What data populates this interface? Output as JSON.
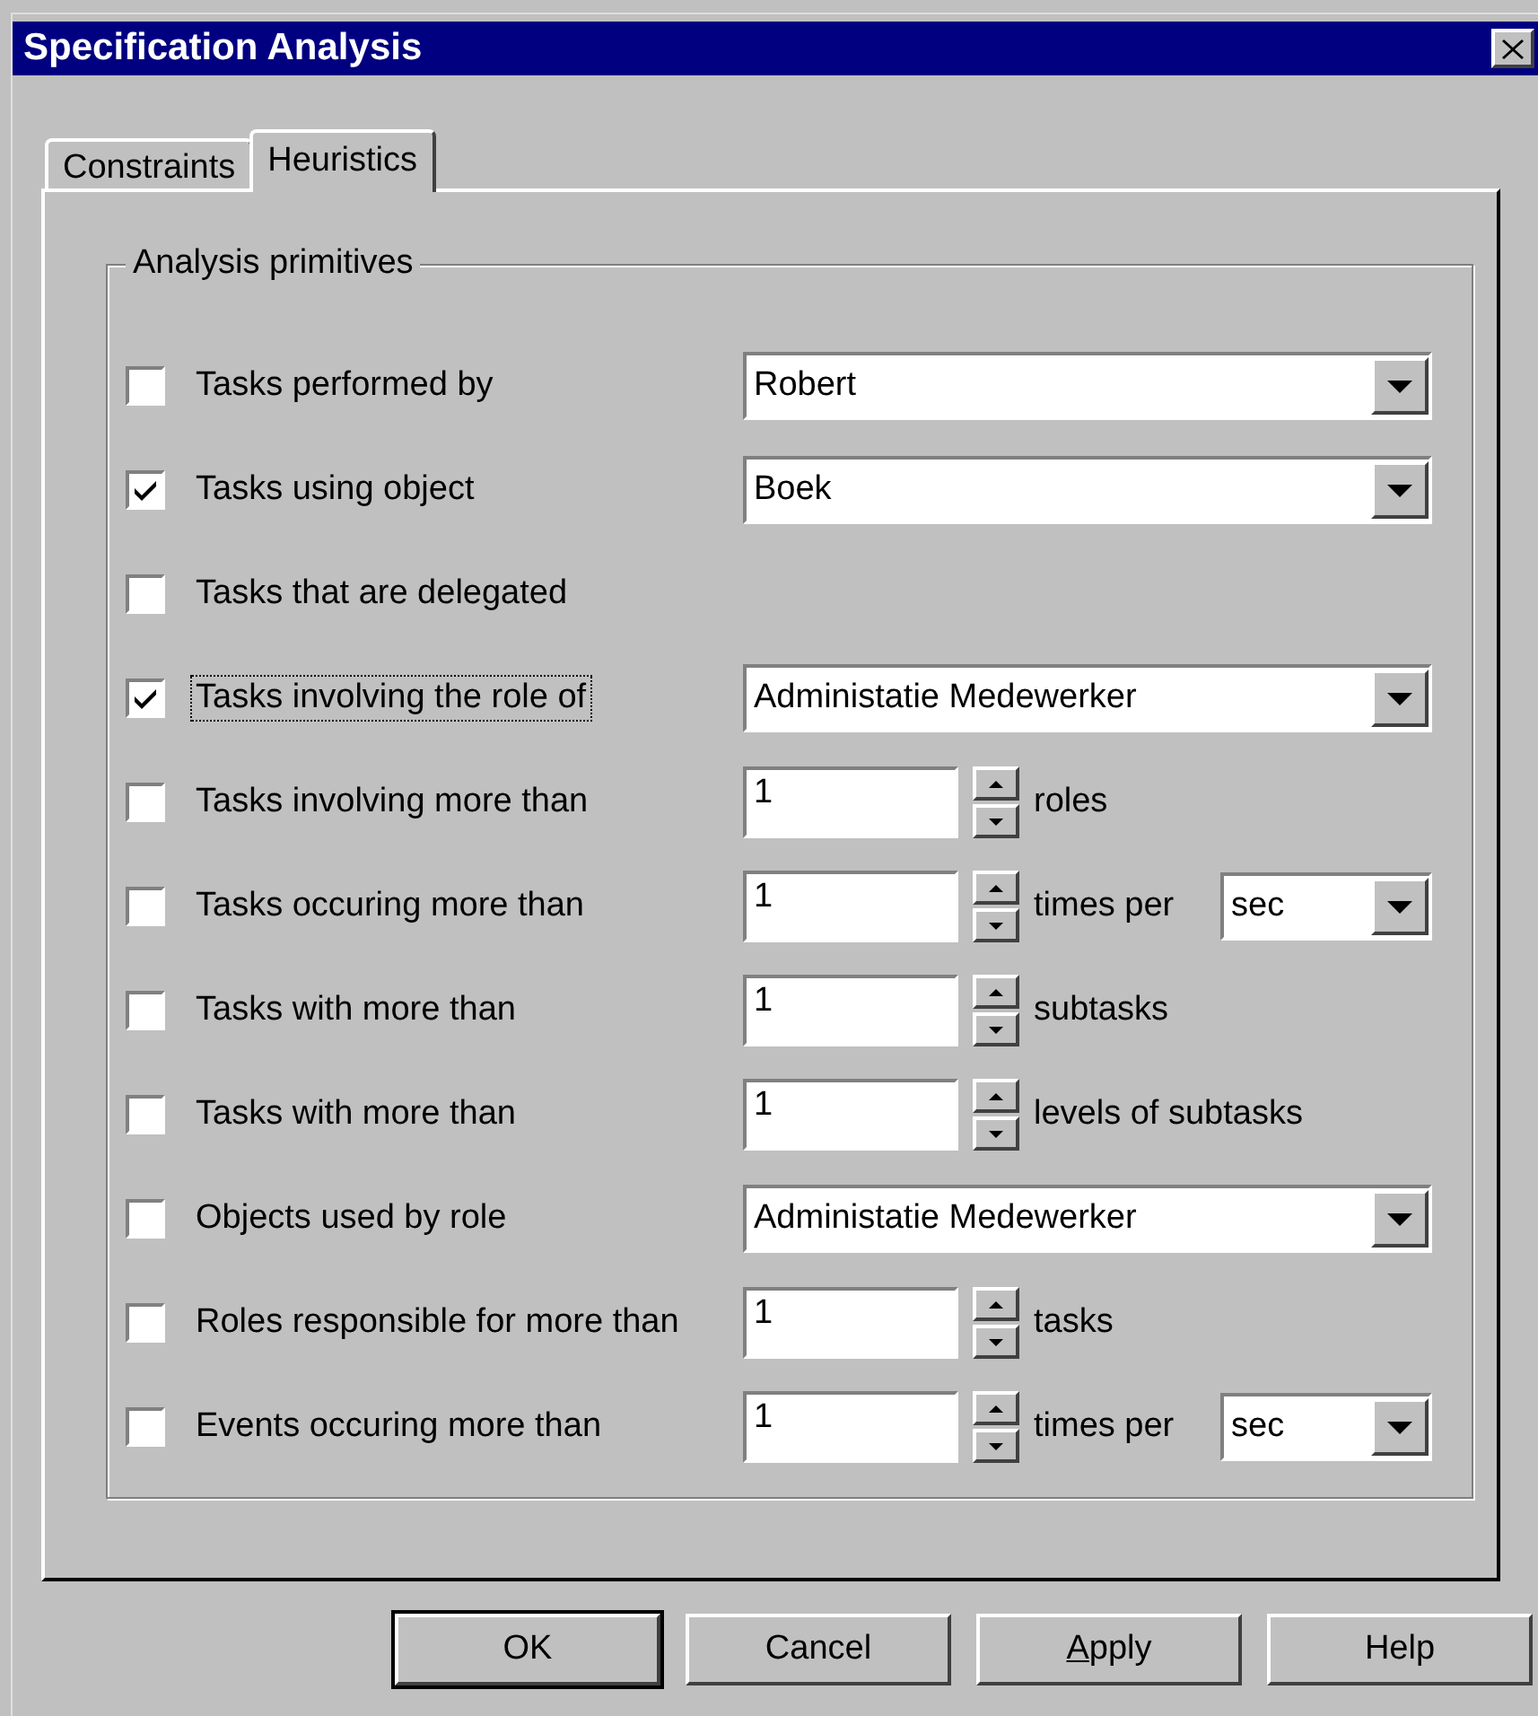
{
  "window": {
    "title": "Specification Analysis"
  },
  "tabs": [
    {
      "label": "Constraints",
      "selected": false
    },
    {
      "label": "Heuristics",
      "selected": true
    }
  ],
  "group": {
    "title": "Analysis primitives"
  },
  "rows": [
    {
      "label": "Tasks performed by",
      "checked": false,
      "focused": false,
      "kind": "combo",
      "value": "Robert"
    },
    {
      "label": "Tasks using object",
      "checked": true,
      "focused": false,
      "kind": "combo",
      "value": "Boek"
    },
    {
      "label": "Tasks that are delegated",
      "checked": false,
      "focused": false,
      "kind": "none"
    },
    {
      "label": "Tasks involving the role of",
      "checked": true,
      "focused": true,
      "kind": "combo",
      "value": "Administatie Medewerker"
    },
    {
      "label": "Tasks involving more than",
      "checked": false,
      "focused": false,
      "kind": "spin",
      "value": "1",
      "suffix": "roles"
    },
    {
      "label": "Tasks occuring more than",
      "checked": false,
      "focused": false,
      "kind": "spin_combo",
      "value": "1",
      "suffix": "times per",
      "unit": "sec"
    },
    {
      "label": "Tasks with more than",
      "checked": false,
      "focused": false,
      "kind": "spin",
      "value": "1",
      "suffix": "subtasks"
    },
    {
      "label": "Tasks with more than",
      "checked": false,
      "focused": false,
      "kind": "spin",
      "value": "1",
      "suffix": "levels of subtasks"
    },
    {
      "label": "Objects used by role",
      "checked": false,
      "focused": false,
      "kind": "combo",
      "value": "Administatie Medewerker"
    },
    {
      "label": "Roles responsible for more than",
      "checked": false,
      "focused": false,
      "kind": "spin",
      "value": "1",
      "suffix": "tasks"
    },
    {
      "label": "Events occuring more than",
      "checked": false,
      "focused": false,
      "kind": "spin_combo",
      "value": "1",
      "suffix": "times per",
      "unit": "sec"
    }
  ],
  "buttons": [
    {
      "label": "OK",
      "default": true
    },
    {
      "label": "Cancel",
      "default": false
    },
    {
      "label": "Apply",
      "default": false,
      "mnemonic_underlined": true
    },
    {
      "label": "Help",
      "default": false
    }
  ]
}
